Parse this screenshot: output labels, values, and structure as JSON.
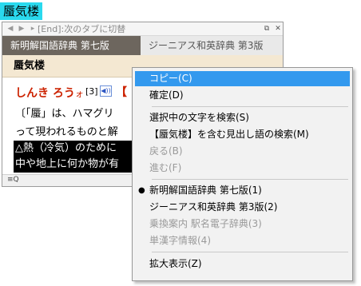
{
  "selection": {
    "text": "蜃気楼"
  },
  "window": {
    "hint": "[End]:次のタブに切替",
    "tabs": [
      "新明解国語辞典 第七版",
      "ジーニアス和英辞典 第3版"
    ],
    "headword": "蜃気楼",
    "entry": {
      "reading": "しんき ろう",
      "accent_mark": "ォ",
      "accent_number": "[3]",
      "bracket_start": "【",
      "line1": "〔「蜃」は、ハマグリ",
      "line2": "って現われるものと解",
      "highlight1": "△熱（冷気）のために",
      "highlight2": "中や地上に何か物が有"
    },
    "status": {
      "zoom_label": "≡Q"
    }
  },
  "context_menu": {
    "items": [
      {
        "label": "コピー(C)",
        "state": "hover"
      },
      {
        "label": "確定(D)",
        "state": "normal"
      },
      {
        "separator": true
      },
      {
        "label": "選択中の文字を検索(S)",
        "state": "normal"
      },
      {
        "label": "【蜃気楼】を含む見出し語の検索(M)",
        "state": "normal"
      },
      {
        "label": "戻る(B)",
        "state": "disabled"
      },
      {
        "label": "進む(F)",
        "state": "disabled"
      },
      {
        "separator": true
      },
      {
        "label": "新明解国語辞典 第七版(1)",
        "state": "checked"
      },
      {
        "label": "ジーニアス和英辞典 第3版(2)",
        "state": "normal"
      },
      {
        "label": "乗換案内 駅名電子辞典(3)",
        "state": "disabled"
      },
      {
        "label": "単漢字情報(4)",
        "state": "disabled"
      },
      {
        "separator": true
      },
      {
        "label": "拡大表示(Z)",
        "state": "normal"
      }
    ]
  },
  "icons": {
    "back": "back-arrow-icon",
    "forward": "forward-arrow-icon",
    "restore": "restore-window-icon",
    "close": "close-icon",
    "speaker": "speaker-icon",
    "zoom": "zoom-icon",
    "bullet": "bullet-icon"
  },
  "colors": {
    "selection_bg": "#2ad9ee",
    "active_tab": "#6d665e",
    "headword_bar": "#f4e8d2",
    "reading": "#cc2200",
    "menu_hover": "#3399ee"
  }
}
